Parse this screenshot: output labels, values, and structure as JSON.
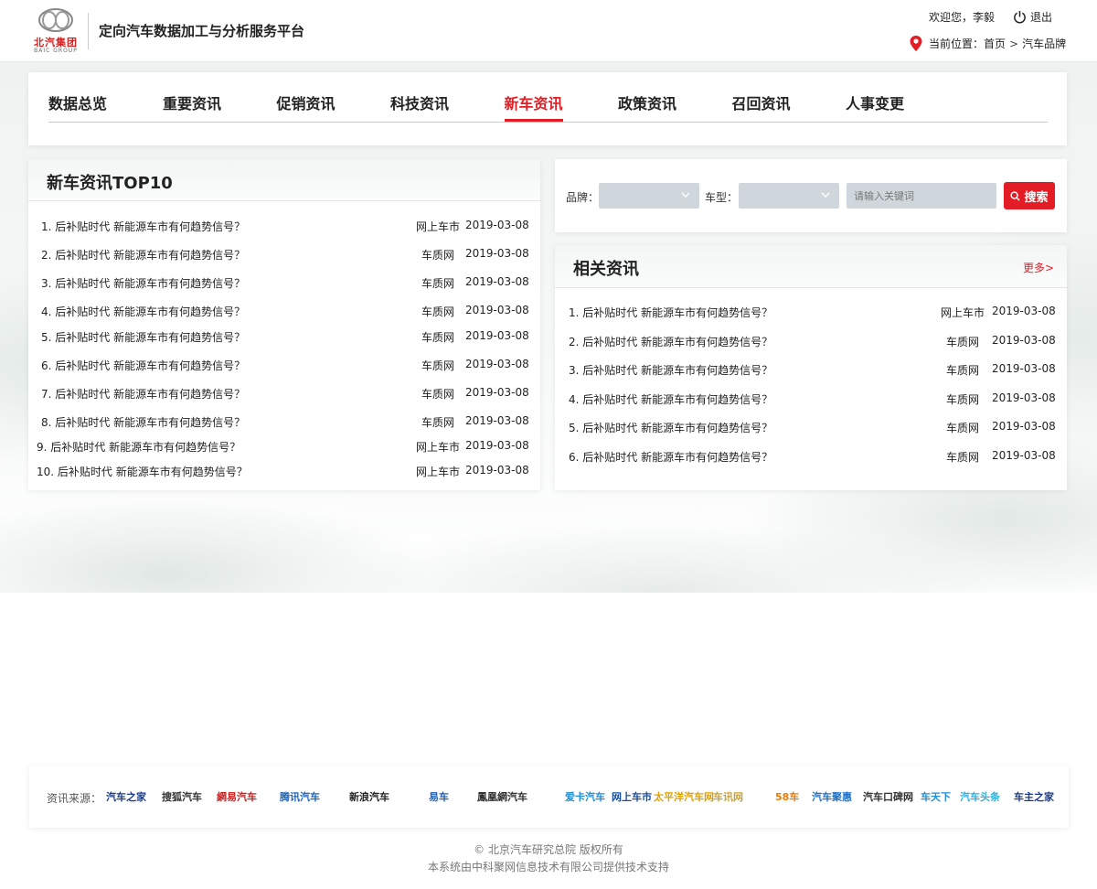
{
  "header": {
    "logo_cn": "北汽集团",
    "logo_en": "BAIC GROUP",
    "platform_title": "定向汽车数据加工与分析服务平台",
    "welcome": "欢迎您，李毅",
    "logout": "退出",
    "location_label": "当前位置：",
    "breadcrumb": [
      "首页",
      "汽车品牌"
    ],
    "breadcrumb_sep": ">"
  },
  "nav": {
    "tabs": [
      "数据总览",
      "重要资讯",
      "促销资讯",
      "科技资讯",
      "新车资讯",
      "政策资讯",
      "召回资讯",
      "人事变更"
    ],
    "active": "新车资讯"
  },
  "top10": {
    "title": "新车资讯TOP10",
    "items": [
      {
        "title": "1. 后补贴时代 新能源车市有何趋势信号？",
        "source": "网上车市",
        "date": "2019-03-08"
      },
      {
        "title": "2. 后补贴时代 新能源车市有何趋势信号？",
        "source": "车质网",
        "date": "2019-03-08"
      },
      {
        "title": "3. 后补贴时代 新能源车市有何趋势信号？",
        "source": "车质网",
        "date": "2019-03-08"
      },
      {
        "title": "4. 后补贴时代 新能源车市有何趋势信号？",
        "source": "车质网",
        "date": "2019-03-08"
      },
      {
        "title": "5. 后补贴时代 新能源车市有何趋势信号？",
        "source": "车质网",
        "date": "2019-03-08"
      },
      {
        "title": "6. 后补贴时代 新能源车市有何趋势信号？",
        "source": "车质网",
        "date": "2019-03-08"
      },
      {
        "title": "7. 后补贴时代 新能源车市有何趋势信号？",
        "source": "车质网",
        "date": "2019-03-08"
      },
      {
        "title": "8. 后补贴时代 新能源车市有何趋势信号？",
        "source": "车质网",
        "date": "2019-03-08"
      },
      {
        "title": "9. 后补贴时代 新能源车市有何趋势信号？",
        "source": "网上车市",
        "date": "2019-03-08"
      },
      {
        "title": "10. 后补贴时代 新能源车市有何趋势信号？",
        "source": "网上车市",
        "date": "2019-03-08"
      }
    ]
  },
  "search": {
    "brand_label": "品牌：",
    "model_label": "车型：",
    "brand_value": "",
    "model_value": "",
    "keyword_placeholder": "请输入关键词",
    "button_label": "搜索"
  },
  "related": {
    "title": "相关资讯",
    "more": "更多>",
    "items": [
      {
        "title": "1. 后补贴时代 新能源车市有何趋势信号？",
        "source": "网上车市",
        "date": "2019-03-08"
      },
      {
        "title": "2. 后补贴时代 新能源车市有何趋势信号？",
        "source": "车质网",
        "date": "2019-03-08"
      },
      {
        "title": "3. 后补贴时代 新能源车市有何趋势信号？",
        "source": "车质网",
        "date": "2019-03-08"
      },
      {
        "title": "4. 后补贴时代 新能源车市有何趋势信号？",
        "source": "车质网",
        "date": "2019-03-08"
      },
      {
        "title": "5. 后补贴时代 新能源车市有何趋势信号？",
        "source": "车质网",
        "date": "2019-03-08"
      },
      {
        "title": "6. 后补贴时代 新能源车市有何趋势信号？",
        "source": "车质网",
        "date": "2019-03-08"
      }
    ]
  },
  "sources": {
    "label": "资讯来源：",
    "logos": [
      {
        "name": "汽车之家",
        "color": "#1a3b8c"
      },
      {
        "name": "搜狐汽车",
        "color": "#333333"
      },
      {
        "name": "網易汽车",
        "color": "#cc1f1f"
      },
      {
        "name": "腾讯汽车",
        "color": "#1a66c2"
      },
      {
        "name": "新浪汽车",
        "color": "#222222"
      },
      {
        "name": "易车",
        "color": "#1f5fb8"
      },
      {
        "name": "鳳凰網汽车",
        "color": "#333333"
      },
      {
        "name": "爱卡汽车",
        "color": "#1e8fd6"
      },
      {
        "name": "网上车市",
        "color": "#1a4fa0"
      },
      {
        "name": "太平洋汽车网",
        "color": "#e0a000"
      },
      {
        "name": "车讯网",
        "color": "#c9a23a"
      },
      {
        "name": "58车",
        "color": "#f07a00"
      },
      {
        "name": "汽车聚惠",
        "color": "#1f6fc4"
      },
      {
        "name": "汽车口碑网",
        "color": "#333333"
      },
      {
        "name": "车天下",
        "color": "#1d8fd8"
      },
      {
        "name": "汽车头条",
        "color": "#2ab0e0"
      },
      {
        "name": "车主之家",
        "color": "#1a3b8c"
      }
    ]
  },
  "footer": {
    "copyright": "©  北京汽车研究总院 版权所有",
    "tech_support": "本系统由中科聚网信息技术有限公司提供技术支持"
  },
  "colors": {
    "accent": "#e21d25",
    "select_bg": "#cfd7dc"
  }
}
